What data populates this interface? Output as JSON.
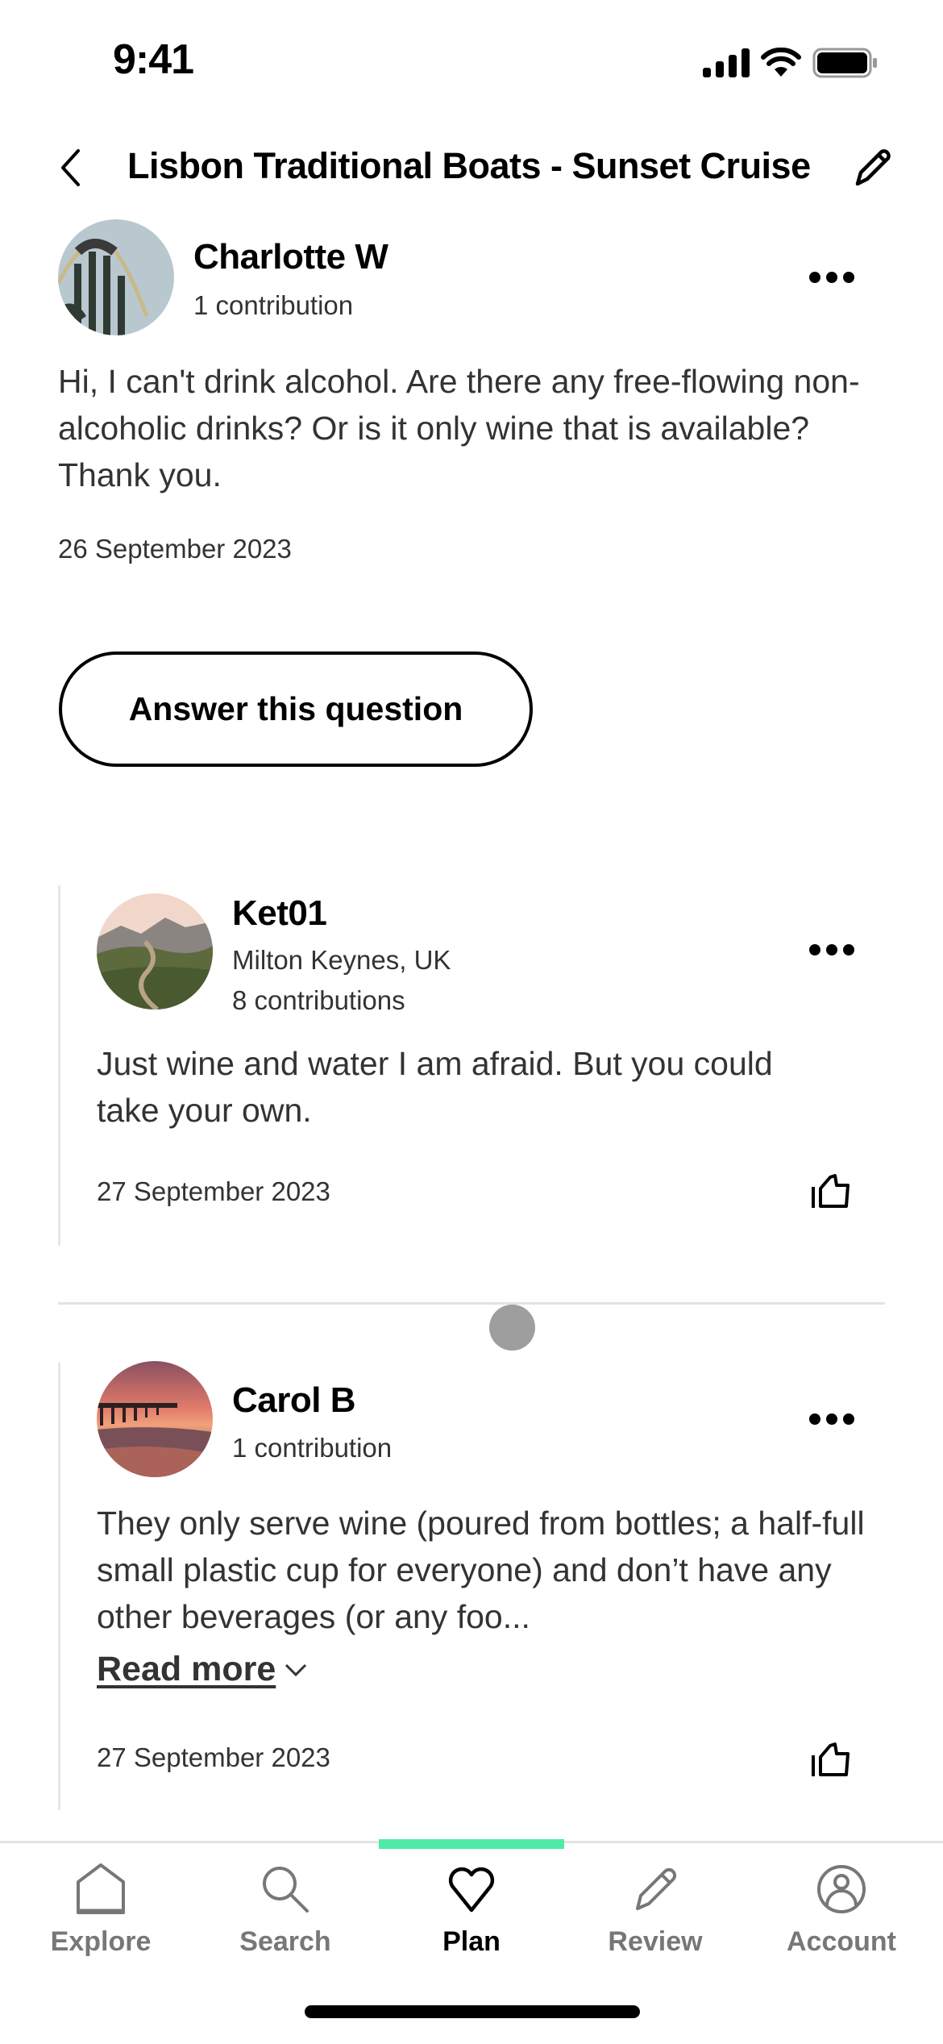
{
  "status_bar": {
    "time": "9:41"
  },
  "header": {
    "title": "Lisbon Traditional Boats - Sunset Cruise",
    "back_icon": "chevron-left-icon",
    "edit_icon": "pencil-icon"
  },
  "question": {
    "author": "Charlotte W",
    "contributions": "1 contribution",
    "text": "Hi, I can't drink alcohol. Are there any free-flowing non-alcoholic drinks? Or is it only wine that is available? Thank you.",
    "date": "26 September 2023",
    "answer_button": "Answer this question"
  },
  "answers": [
    {
      "author": "Ket01",
      "location": "Milton Keynes, UK",
      "contributions": "8 contributions",
      "text": "Just wine and water I am afraid. But you could take your own.",
      "date": "27 September 2023"
    },
    {
      "author": "Carol B",
      "contributions": "1 contribution",
      "text": "They only serve wine (poured from bottles; a half-full small plastic cup for everyone) and don’t have any other beverages (or any foo...",
      "read_more": "Read more",
      "date": "27 September 2023"
    }
  ],
  "tabbar": {
    "active_color": "#4deba6",
    "items": [
      {
        "label": "Explore",
        "icon": "home-icon",
        "active": false
      },
      {
        "label": "Search",
        "icon": "search-icon",
        "active": false
      },
      {
        "label": "Plan",
        "icon": "heart-icon",
        "active": true
      },
      {
        "label": "Review",
        "icon": "pencil-icon",
        "active": false
      },
      {
        "label": "Account",
        "icon": "account-icon",
        "active": false
      }
    ]
  }
}
